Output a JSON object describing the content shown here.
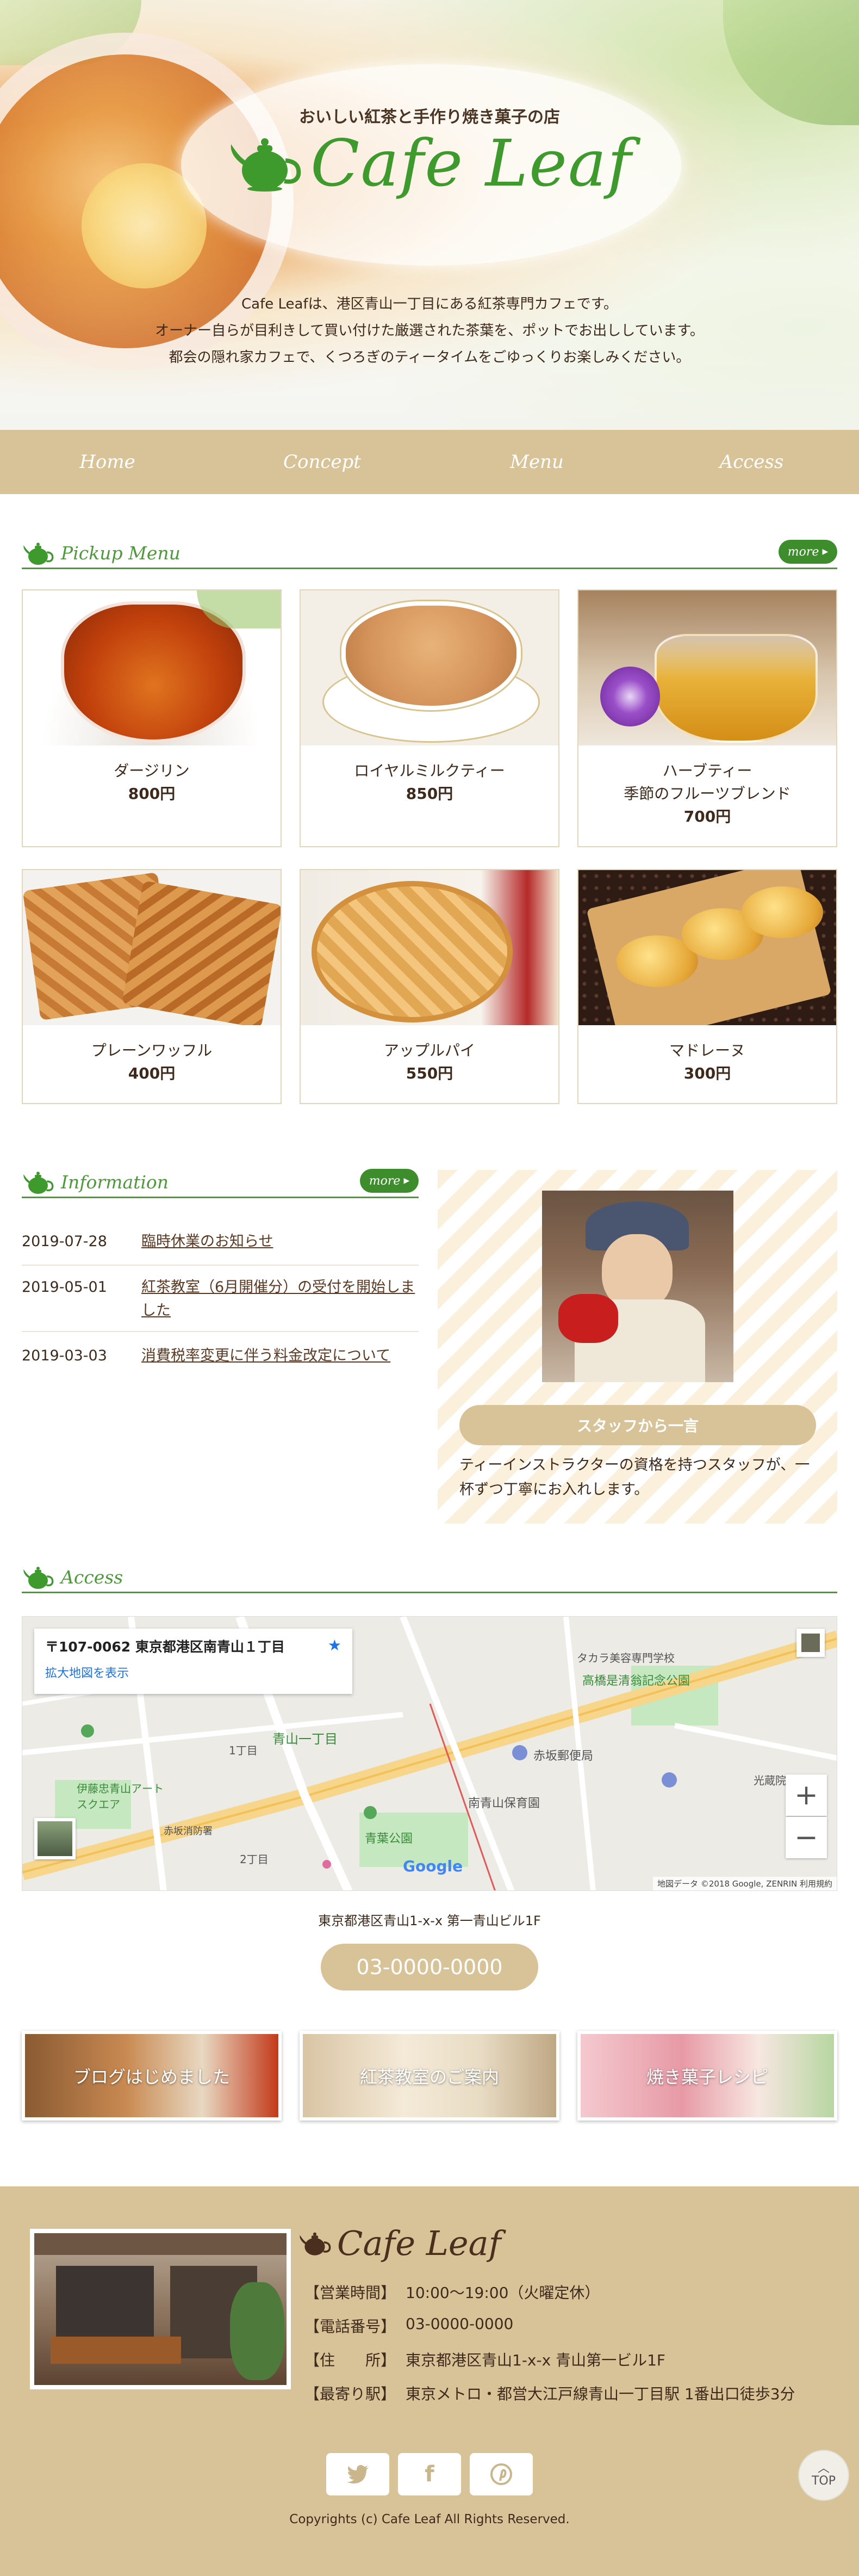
{
  "hero": {
    "tagline": "おいしい紅茶と手作り焼き菓子の店",
    "logo": "Cafe Leaf",
    "desc_lines": [
      "Cafe Leafは、港区青山一丁目にある紅茶専門カフェです。",
      "オーナー自らが目利きして買い付けた厳選された茶葉を、ポットでお出ししています。",
      "都会の隠れ家カフェで、くつろぎのティータイムをごゆっくりお楽しみください。"
    ]
  },
  "nav": [
    "Home",
    "Concept",
    "Menu",
    "Access"
  ],
  "pickup": {
    "title": "Pickup Menu",
    "more": "more",
    "items": [
      {
        "name": "ダージリン",
        "price": "800円"
      },
      {
        "name": "ロイヤルミルクティー",
        "price": "850円"
      },
      {
        "name": "ハーブティー",
        "sub": "季節のフルーツブレンド",
        "price": "700円"
      },
      {
        "name": "プレーンワッフル",
        "price": "400円"
      },
      {
        "name": "アップルパイ",
        "price": "550円"
      },
      {
        "name": "マドレーヌ",
        "price": "300円"
      }
    ]
  },
  "information": {
    "title": "Information",
    "more": "more",
    "items": [
      {
        "date": "2019-07-28",
        "text": "臨時休業のお知らせ"
      },
      {
        "date": "2019-05-01",
        "text": "紅茶教室（6月開催分）の受付を開始しました"
      },
      {
        "date": "2019-03-03",
        "text": "消費税率変更に伴う料金改定について"
      }
    ]
  },
  "staff": {
    "button": "スタッフから一言",
    "text": "ティーインストラクターの資格を持つスタッフが、一杯ずつ丁寧にお入れします。"
  },
  "access": {
    "title": "Access",
    "map": {
      "address": "〒107-0062 東京都港区南青山１丁目",
      "enlarge": "拡大地図を表示",
      "credit": "地図データ ©2018 Google, ZENRIN   利用規約",
      "google": "Google",
      "labels": [
        "青山一丁目",
        "赤坂郵便局",
        "高橋是清翁記念公園",
        "青葉公園",
        "南青山保育園",
        "伊藤忠青山アートスクエア",
        "赤坂消防署",
        "1丁目",
        "2丁目",
        "光蔵院",
        "タカラ美容専門学校"
      ]
    },
    "address": "東京都港区青山1-x-x 第一青山ビル1F",
    "phone": "03-0000-0000"
  },
  "banners": [
    "ブログはじめました",
    "紅茶教室のご案内",
    "焼き菓子レシピ"
  ],
  "footer": {
    "logo": "Cafe Leaf",
    "rows": [
      {
        "label": "【営業時間】",
        "value": "10:00〜19:00（火曜定休）"
      },
      {
        "label": "【電話番号】",
        "value": "03-0000-0000"
      },
      {
        "label": "【住　　所】",
        "value": "東京都港区青山1-x-x 青山第一ビル1F"
      },
      {
        "label": "【最寄り駅】",
        "value": "東京メトロ・都営大江戸線青山一丁目駅 1番出口徒歩3分"
      }
    ],
    "social": [
      "twitter-icon",
      "facebook-icon",
      "pinterest-icon"
    ],
    "copyright": "Copyrights (c) Cafe Leaf All Rights Reserved.",
    "top": "TOP"
  },
  "colors": {
    "beige": "#d8c399",
    "green": "#4e9a3a",
    "brown": "#3d2a1c"
  }
}
